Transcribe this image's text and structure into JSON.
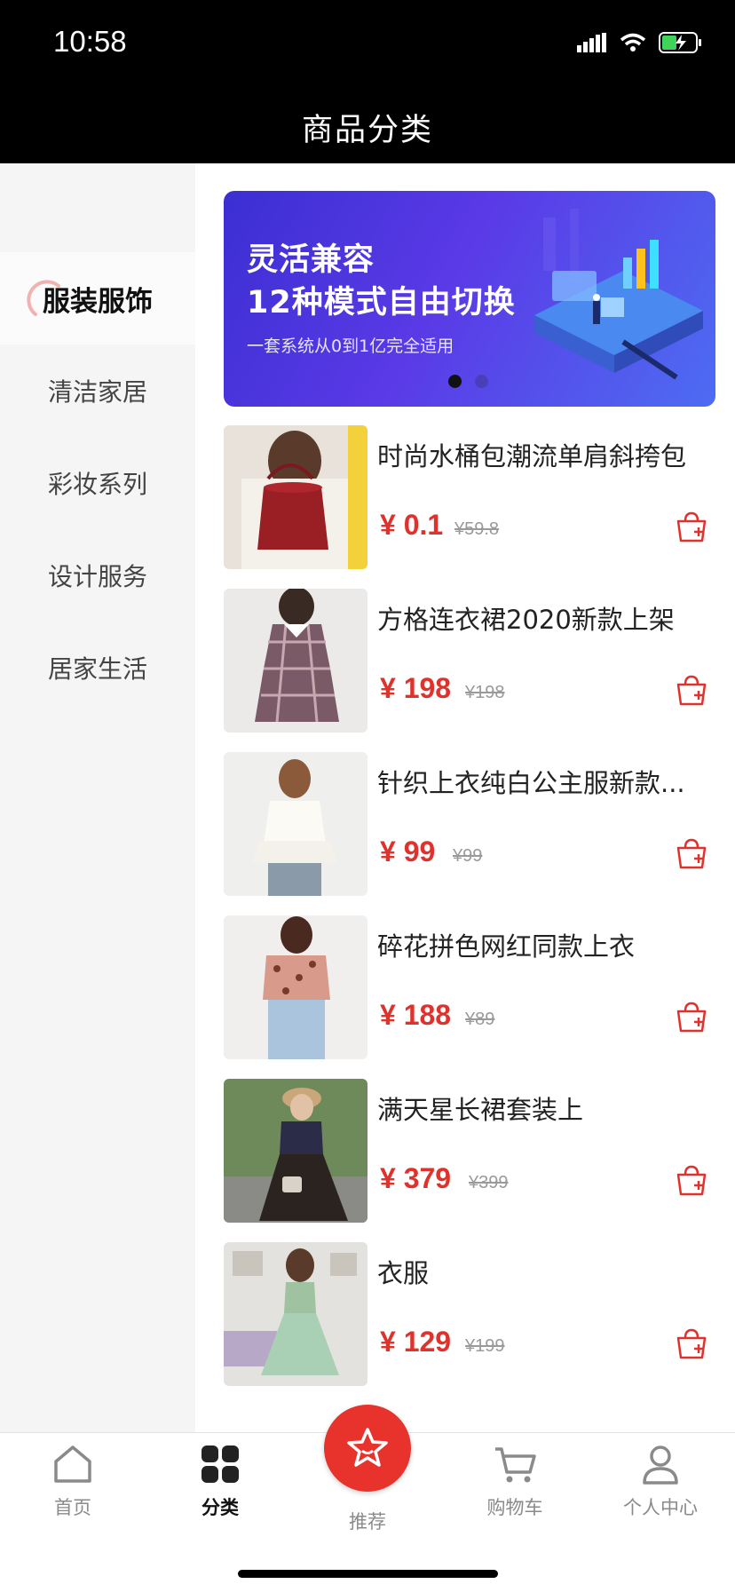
{
  "status_bar": {
    "time": "10:58"
  },
  "header": {
    "title": "商品分类"
  },
  "sidebar": {
    "items": [
      {
        "label": "服装服饰",
        "active": true
      },
      {
        "label": "清洁家居",
        "active": false
      },
      {
        "label": "彩妆系列",
        "active": false
      },
      {
        "label": "设计服务",
        "active": false
      },
      {
        "label": "居家生活",
        "active": false
      }
    ]
  },
  "banner": {
    "line1": "灵活兼容",
    "line2": "12种模式自由切换",
    "subtitle": "一套系统从0到1亿完全适用",
    "dots": 2,
    "active_dot": 0
  },
  "products": [
    {
      "name": "时尚水桶包潮流单肩斜挎包",
      "price": "¥ 0.1",
      "old_price": "¥59.8"
    },
    {
      "name": "方格连衣裙2020新款上架",
      "price": "¥ 198",
      "old_price": "¥198"
    },
    {
      "name": "针织上衣纯白公主服新款...",
      "price": "¥ 99",
      "old_price": "¥99"
    },
    {
      "name": "碎花拼色网红同款上衣",
      "price": "¥ 188",
      "old_price": "¥89"
    },
    {
      "name": "满天星长裙套装上",
      "price": "¥ 379",
      "old_price": "¥399"
    },
    {
      "name": "衣服",
      "price": "¥ 129",
      "old_price": "¥199"
    }
  ],
  "tabbar": {
    "items": [
      {
        "label": "首页",
        "icon": "home-icon"
      },
      {
        "label": "分类",
        "icon": "category-grid-icon",
        "active": true
      },
      {
        "label": "推荐",
        "icon": "star-icon"
      },
      {
        "label": "购物车",
        "icon": "cart-icon"
      },
      {
        "label": "个人中心",
        "icon": "user-icon"
      }
    ]
  },
  "colors": {
    "accent": "#e0322c",
    "header_bg": "#000000",
    "sidebar_bg": "#f5f5f5"
  }
}
